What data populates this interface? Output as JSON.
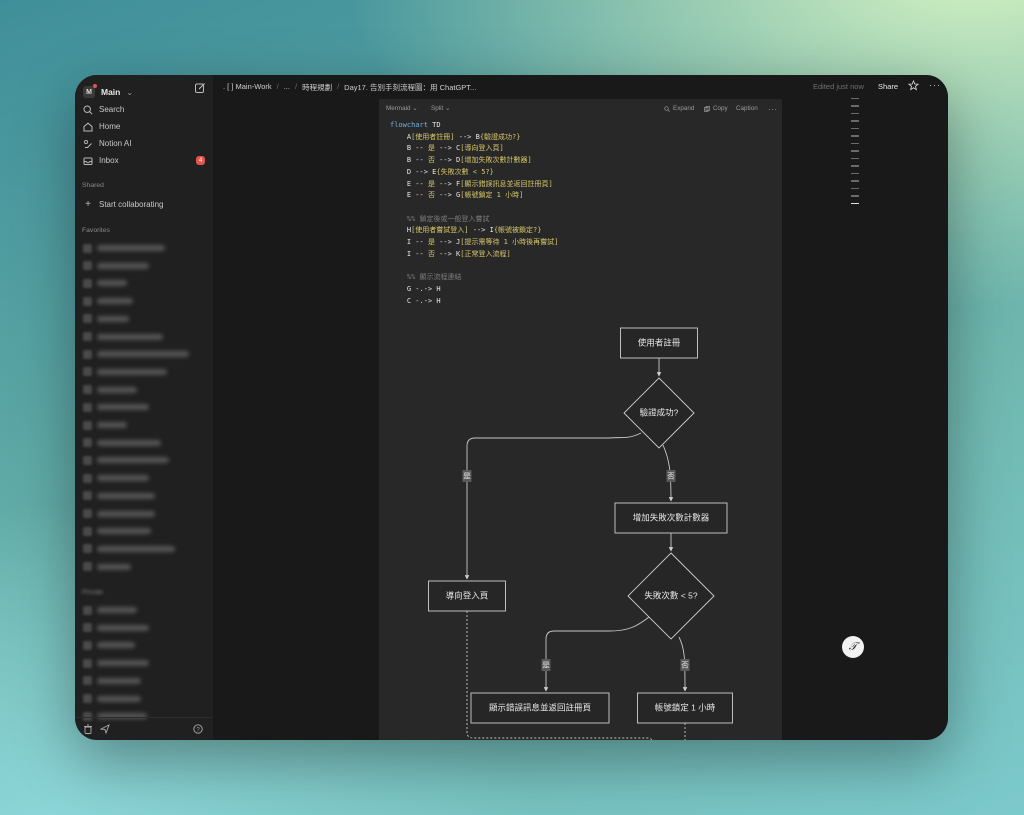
{
  "sidebar": {
    "workspace_initial": "M",
    "workspace_name": "Main",
    "nav": [
      {
        "label": "Search",
        "icon": "search-icon"
      },
      {
        "label": "Home",
        "icon": "home-icon"
      },
      {
        "label": "Notion AI",
        "icon": "notion-ai-icon"
      },
      {
        "label": "Inbox",
        "icon": "inbox-icon",
        "badge": "4"
      }
    ],
    "shared_heading": "Shared",
    "start_collab": "Start collaborating",
    "favorites_heading": "Favorites",
    "private_heading": "Private"
  },
  "topbar": {
    "breadcrumbs": [
      ". [ ] Main-Work",
      "...",
      "時程規劃",
      "Day17. 告別手刻流程圖：用 ChatGPT..."
    ],
    "edited": "Edited just now",
    "share": "Share"
  },
  "code_block": {
    "language": "Mermaid",
    "view": "Split",
    "actions": {
      "expand": "Expand",
      "copy": "Copy",
      "caption": "Caption"
    },
    "lines": [
      [
        {
          "t": "flowchart",
          "c": "kw"
        },
        {
          "t": " TD"
        }
      ],
      [
        {
          "t": "    A"
        },
        {
          "t": "[使用者註冊]",
          "c": "st"
        },
        {
          "t": " --> B"
        },
        {
          "t": "{驗證成功?}",
          "c": "st"
        }
      ],
      [
        {
          "t": "    B -- "
        },
        {
          "t": "是",
          "c": "st"
        },
        {
          "t": " --> C"
        },
        {
          "t": "[導向登入頁]",
          "c": "st"
        }
      ],
      [
        {
          "t": "    B -- "
        },
        {
          "t": "否",
          "c": "st"
        },
        {
          "t": " --> D"
        },
        {
          "t": "[增加失敗次數計數器]",
          "c": "st"
        }
      ],
      [
        {
          "t": "    D --> E"
        },
        {
          "t": "{失敗次數 < 5?}",
          "c": "st"
        }
      ],
      [
        {
          "t": "    E -- "
        },
        {
          "t": "是",
          "c": "st"
        },
        {
          "t": " --> F"
        },
        {
          "t": "[顯示錯誤訊息並返回註冊頁]",
          "c": "st"
        }
      ],
      [
        {
          "t": "    E -- "
        },
        {
          "t": "否",
          "c": "st"
        },
        {
          "t": " --> G"
        },
        {
          "t": "[帳號鎖定 1 小時]",
          "c": "st"
        }
      ],
      [
        {
          "t": ""
        }
      ],
      [
        {
          "t": "    %% 鎖定後或一般登入嘗試",
          "c": "cm"
        }
      ],
      [
        {
          "t": "    H"
        },
        {
          "t": "[使用者嘗試登入]",
          "c": "st"
        },
        {
          "t": " --> I"
        },
        {
          "t": "{帳號被鎖定?}",
          "c": "st"
        }
      ],
      [
        {
          "t": "    I -- "
        },
        {
          "t": "是",
          "c": "st"
        },
        {
          "t": " --> J"
        },
        {
          "t": "[提示需等待 1 小時後再嘗試]",
          "c": "st"
        }
      ],
      [
        {
          "t": "    I -- "
        },
        {
          "t": "否",
          "c": "st"
        },
        {
          "t": " --> K"
        },
        {
          "t": "[正常登入流程]",
          "c": "st"
        }
      ],
      [
        {
          "t": ""
        }
      ],
      [
        {
          "t": "    %% 顯示流程連結",
          "c": "cm"
        }
      ],
      [
        {
          "t": "    G -.-> H"
        }
      ],
      [
        {
          "t": "    C -.-> H"
        }
      ]
    ]
  },
  "diagram": {
    "nodes": {
      "A": "使用者註冊",
      "B": "驗證成功?",
      "C": "導向登入頁",
      "D": "增加失敗次數計數器",
      "E": "失敗次數 < 5?",
      "F": "顯示錯誤訊息並返回註冊頁",
      "G": "帳號鎖定 1 小時"
    },
    "edge_labels": {
      "yes": "是",
      "no": "否"
    }
  },
  "colors": {
    "accent_badge": "#e0574f",
    "node_stroke": "#cfcfcf",
    "code_string": "#d8c76a",
    "code_keyword": "#6fb1e8"
  }
}
